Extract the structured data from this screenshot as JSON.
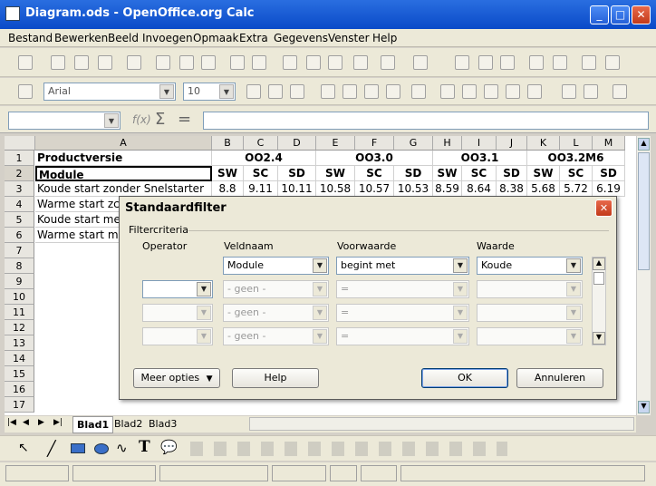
{
  "window": {
    "title": "Diagram.ods - OpenOffice.org Calc"
  },
  "menu": [
    "Bestand",
    "Bewerken",
    "Beeld",
    "Invoegen",
    "Opmaak",
    "Extra",
    "Gegevens",
    "Venster",
    "Help"
  ],
  "format_toolbar": {
    "font": "Arial",
    "size": "10"
  },
  "formula_bar": {
    "name_box": "",
    "formula": ""
  },
  "sheet": {
    "columns": [
      "A",
      "B",
      "C",
      "D",
      "E",
      "F",
      "G",
      "H",
      "I",
      "J",
      "K",
      "L",
      "M"
    ],
    "row_numbers": [
      "1",
      "2",
      "3",
      "4",
      "5",
      "6",
      "7",
      "8",
      "9",
      "10",
      "11",
      "12",
      "13",
      "14",
      "15",
      "16",
      "17"
    ],
    "row1": {
      "a": "Productversie",
      "g1": "OO2.4",
      "g2": "OO3.0",
      "g3": "OO3.1",
      "g4": "OO3.2M6"
    },
    "row2": [
      "Module",
      "SW",
      "SC",
      "SD",
      "SW",
      "SC",
      "SD",
      "SW",
      "SC",
      "SD",
      "SW",
      "SC",
      "SD"
    ],
    "row3": [
      "Koude start zonder Snelstarter",
      "8.8",
      "9.11",
      "10.11",
      "10.58",
      "10.57",
      "10.53",
      "8.59",
      "8.64",
      "8.38",
      "5.68",
      "5.72",
      "6.19"
    ],
    "row4": [
      "Warme start zc"
    ],
    "row5": [
      "Koude start me"
    ],
    "row6": [
      "Warme start m"
    ]
  },
  "sheet_tabs": [
    "Blad1",
    "Blad2",
    "Blad3"
  ],
  "dialog": {
    "title": "Standaardfilter",
    "group": "Filtercriteria",
    "headers": {
      "operator": "Operator",
      "field": "Veldnaam",
      "condition": "Voorwaarde",
      "value": "Waarde"
    },
    "row1": {
      "field": "Module",
      "condition": "begint met",
      "value": "Koude"
    },
    "rows": [
      {
        "operator": "",
        "field": "- geen -",
        "condition": "=",
        "value": ""
      },
      {
        "operator": "",
        "field": "- geen -",
        "condition": "=",
        "value": ""
      },
      {
        "operator": "",
        "field": "- geen -",
        "condition": "=",
        "value": ""
      }
    ],
    "buttons": {
      "more": "Meer opties",
      "help": "Help",
      "ok": "OK",
      "cancel": "Annuleren"
    }
  }
}
